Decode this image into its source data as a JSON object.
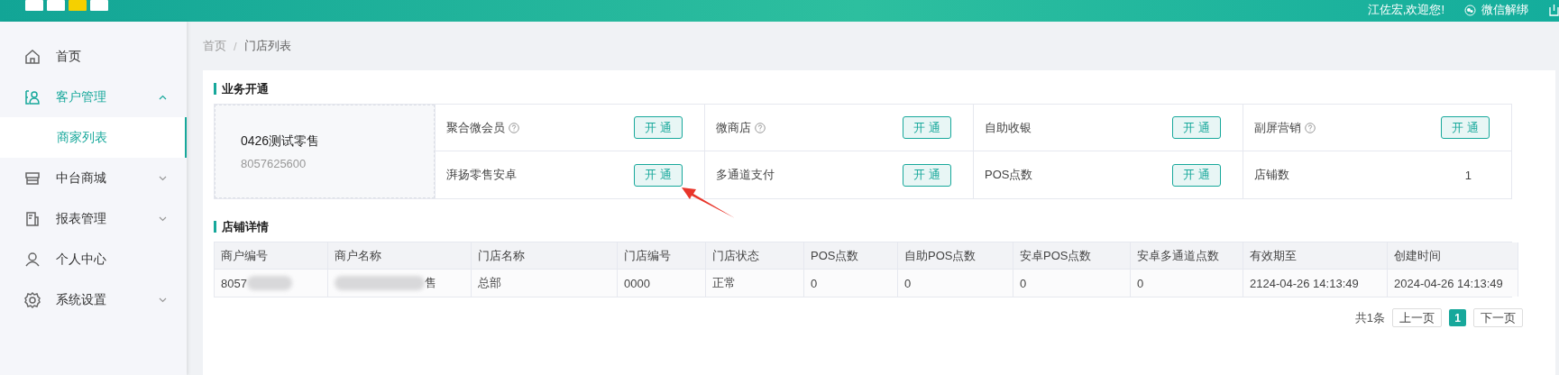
{
  "header": {
    "welcome": "江佐宏,欢迎您!",
    "unbind": "微信解绑"
  },
  "sidebar": {
    "items": [
      {
        "label": "首页",
        "kind": "link",
        "selected": false
      },
      {
        "label": "客户管理",
        "kind": "group",
        "expanded": true,
        "selected": true,
        "children": [
          {
            "label": "商家列表",
            "selected": true
          }
        ]
      },
      {
        "label": "中台商城",
        "kind": "group",
        "expanded": false,
        "selected": false
      },
      {
        "label": "报表管理",
        "kind": "group",
        "expanded": false,
        "selected": false
      },
      {
        "label": "个人中心",
        "kind": "link",
        "selected": false
      },
      {
        "label": "系统设置",
        "kind": "group",
        "expanded": false,
        "selected": false
      }
    ]
  },
  "breadcrumb": {
    "items": [
      "首页",
      "门店列表"
    ],
    "separator": "/"
  },
  "business": {
    "title": "业务开通",
    "store_name": "0426测试零售",
    "store_id": "8057625600",
    "services": [
      {
        "label": "聚合微会员",
        "help": true,
        "kind": "button",
        "action": "开通"
      },
      {
        "label": "微商店",
        "help": true,
        "kind": "button",
        "action": "开通"
      },
      {
        "label": "自助收银",
        "help": false,
        "kind": "button",
        "action": "开通"
      },
      {
        "label": "副屏营销",
        "help": true,
        "kind": "button",
        "action": "开通"
      },
      {
        "label": "湃扬零售安卓",
        "help": false,
        "kind": "button",
        "action": "开通"
      },
      {
        "label": "多通道支付",
        "help": false,
        "kind": "button",
        "action": "开通"
      },
      {
        "label": "POS点数",
        "help": false,
        "kind": "button",
        "action": "开通"
      },
      {
        "label": "店铺数",
        "help": false,
        "kind": "value",
        "action": "1"
      }
    ]
  },
  "details": {
    "title": "店铺详情",
    "columns": [
      "商户编号",
      "商户名称",
      "门店名称",
      "门店编号",
      "门店状态",
      "POS点数",
      "自助POS点数",
      "安卓POS点数",
      "安卓多通道点数",
      "有效期至",
      "创建时间"
    ],
    "rows": [
      [
        {
          "text": "8057",
          "blurred_after": true
        },
        {
          "text": "售",
          "blurred_before": true
        },
        {
          "text": "总部"
        },
        {
          "text": "0000"
        },
        {
          "text": "正常"
        },
        {
          "text": "0"
        },
        {
          "text": "0"
        },
        {
          "text": "0"
        },
        {
          "text": "0"
        },
        {
          "text": "2124-04-26 14:13:49"
        },
        {
          "text": "2024-04-26 14:13:49"
        }
      ]
    ]
  },
  "pagination": {
    "total": "共1条",
    "prev": "上一页",
    "pages": [
      {
        "label": "1",
        "selected": true
      }
    ],
    "next": "下一页"
  }
}
